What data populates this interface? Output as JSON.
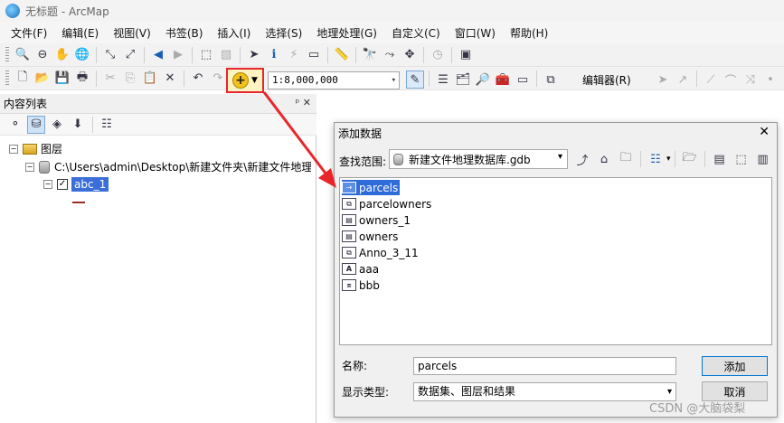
{
  "window": {
    "title": "无标题 - ArcMap"
  },
  "menu": [
    "文件(F)",
    "编辑(E)",
    "视图(V)",
    "书签(B)",
    "插入(I)",
    "选择(S)",
    "地理处理(G)",
    "自定义(C)",
    "窗口(W)",
    "帮助(H)"
  ],
  "toolbar": {
    "scale_value": "1:8,000,000",
    "editor_label": "编辑器(R)"
  },
  "toc": {
    "title": "内容列表",
    "controls": "ᵖ ✕",
    "layers_root": "图层",
    "db_path": "C:\\Users\\admin\\Desktop\\新建文件夹\\新建文件地理",
    "layer_name": "abc_1"
  },
  "dialog": {
    "title": "添加数据",
    "look_in_label": "查找范围:",
    "look_in_value": "新建文件地理数据库.gdb",
    "items": [
      {
        "name": "parcels",
        "icon": "feature-class-icon",
        "selected": true
      },
      {
        "name": "parcelowners",
        "icon": "relationship-class-icon",
        "selected": false
      },
      {
        "name": "owners_1",
        "icon": "table-icon",
        "selected": false
      },
      {
        "name": "owners",
        "icon": "table-icon",
        "selected": false
      },
      {
        "name": "Anno_3_11",
        "icon": "relationship-class-icon",
        "selected": false
      },
      {
        "name": "aaa",
        "icon": "annotation-icon",
        "selected": false
      },
      {
        "name": "bbb",
        "icon": "feature-dataset-icon",
        "selected": false
      }
    ],
    "name_label": "名称:",
    "name_value": "parcels",
    "type_label": "显示类型:",
    "type_value": "数据集、图层和结果",
    "add_button": "添加",
    "cancel_button": "取消"
  },
  "watermark": "CSDN @大脑袋梨",
  "colors": {
    "selection": "#2f6bd9",
    "highlight_box": "#e8262a",
    "arrow": "#e8262a"
  }
}
